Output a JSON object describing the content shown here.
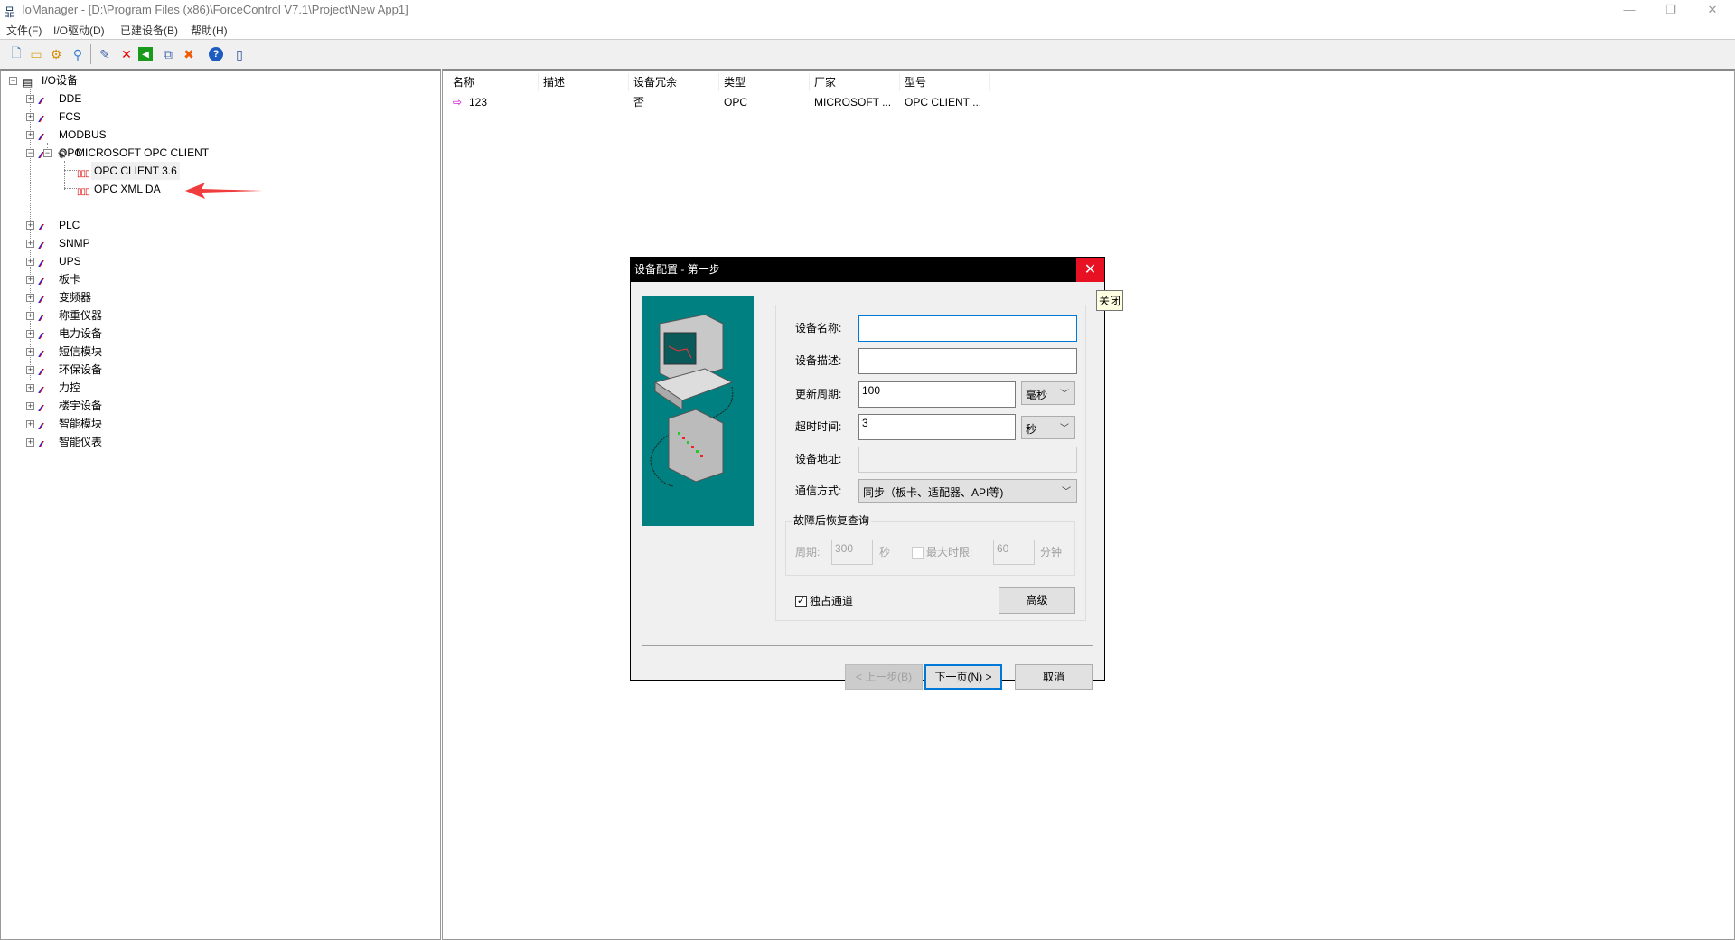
{
  "window": {
    "title": "IoManager - [D:\\Program Files (x86)\\ForceControl V7.1\\Project\\New App1]",
    "minimize": "—",
    "restore": "❐",
    "close": "✕"
  },
  "menu": [
    "文件(F)",
    "I/O驱动(D)",
    "已建设备(B)",
    "帮助(H)"
  ],
  "toolbar": [
    "new-file",
    "open-folder",
    "device",
    "find",
    "edit",
    "delete",
    "back",
    "copy-config",
    "delete-all",
    "help",
    "exit"
  ],
  "tree": {
    "root": "I/O设备",
    "items": [
      "DDE",
      "FCS",
      "MODBUS",
      "OPC",
      "PLC",
      "SNMP",
      "UPS",
      "板卡",
      "变频器",
      "称重仪器",
      "电力设备",
      "短信模块",
      "环保设备",
      "力控",
      "楼宇设备",
      "智能模块",
      "智能仪表"
    ],
    "opc_vendor": "MICROSOFT OPC CLIENT",
    "opc_drivers": [
      "OPC CLIENT 3.6",
      "OPC XML DA"
    ]
  },
  "list": {
    "columns": [
      "名称",
      "描述",
      "设备冗余",
      "类型",
      "厂家",
      "型号"
    ],
    "rows": [
      [
        "123",
        "",
        "否",
        "OPC",
        "MICROSOFT ...",
        "OPC CLIENT ..."
      ]
    ]
  },
  "dialog": {
    "title": "设备配置 - 第一步",
    "tooltip": "关闭",
    "name_label": "设备名称:",
    "name_value": "",
    "desc_label": "设备描述:",
    "desc_value": "",
    "period_label": "更新周期:",
    "period_value": "100",
    "period_unit": "毫秒",
    "timeout_label": "超时时间:",
    "timeout_value": "3",
    "timeout_unit": "秒",
    "addr_label": "设备地址:",
    "addr_value": "",
    "comm_label": "通信方式:",
    "comm_value": "同步（板卡、适配器、API等)",
    "group_title": "故障后恢复查询",
    "cycle_label": "周期:",
    "cycle_value": "300",
    "cycle_unit": "秒",
    "maxtime_label": "最大时限:",
    "maxtime_value": "60",
    "maxtime_unit": "分钟",
    "exclusive_label": "独占通道",
    "exclusive_checked": true,
    "advanced": "高级",
    "prev": "< 上一步(B)",
    "next": "下一页(N) >",
    "cancel": "取消"
  },
  "colors": {
    "accent": "#0078d7",
    "close_red": "#e81123",
    "teal": "#008080",
    "arrow": "#f03c3c"
  }
}
